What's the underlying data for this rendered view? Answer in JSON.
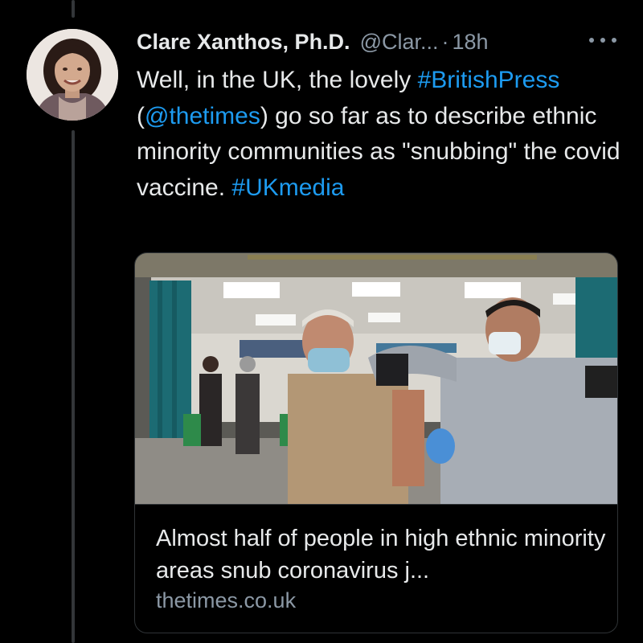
{
  "tweet": {
    "author": {
      "display_name": "Clare Xanthos, Ph.D.",
      "handle": "@Clar...",
      "avatar": "profile-photo"
    },
    "separator": "·",
    "time": "18h",
    "more_icon": "ellipsis-icon",
    "text": {
      "part1": "Well, in the UK, the lovely ",
      "hashtag1": "#BritishPress",
      "part2": " (",
      "mention": "@thetimes",
      "part3": ") go so far as to describe ethnic minority communities as \"snubbing\" the covid vaccine.  ",
      "hashtag2": "#UKmedia"
    },
    "link_card": {
      "title": "Almost half of people in high ethnic minority areas snub coronavirus j...",
      "domain": "thetimes.co.uk"
    }
  },
  "colors": {
    "background": "#000000",
    "text": "#e7e9ea",
    "secondary": "#8b98a5",
    "link": "#1d9bf0",
    "border": "#2f3336"
  }
}
